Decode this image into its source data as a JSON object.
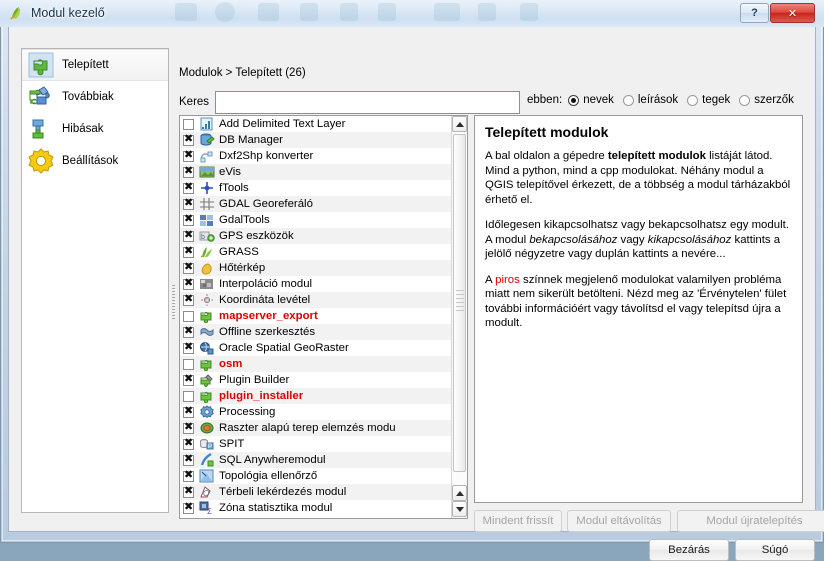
{
  "window": {
    "title": "Modul kezelő",
    "icon": "qgis-plugin-icon",
    "help_button": "?",
    "close_button": "✕"
  },
  "sidebar": {
    "items": [
      {
        "label": "Telepített",
        "icon": "puzzle-green-icon",
        "selected": true
      },
      {
        "label": "Továbbiak",
        "icon": "puzzle-blue-green-icon",
        "selected": false
      },
      {
        "label": "Hibásak",
        "icon": "puzzle-broken-icon",
        "selected": false
      },
      {
        "label": "Beállítások",
        "icon": "gear-yellow-icon",
        "selected": false
      }
    ]
  },
  "content": {
    "breadcrumb": "Modulok > Telepített (26)",
    "search": {
      "label": "Keres",
      "value": "",
      "placeholder": ""
    },
    "filter": {
      "label": "ebben:",
      "options": [
        {
          "label": "nevek",
          "selected": true
        },
        {
          "label": "leírások",
          "selected": false
        },
        {
          "label": "tegek",
          "selected": false
        },
        {
          "label": "szerzők",
          "selected": false
        }
      ]
    },
    "plugins": [
      {
        "name": "Add Delimited Text Layer",
        "checked": false,
        "broken": false,
        "icon": "delimited-text-icon"
      },
      {
        "name": "DB Manager",
        "checked": true,
        "broken": false,
        "icon": "db-manager-icon"
      },
      {
        "name": "Dxf2Shp konverter",
        "checked": true,
        "broken": false,
        "icon": "dxf2shp-icon"
      },
      {
        "name": "eVis",
        "checked": true,
        "broken": false,
        "icon": "evis-icon"
      },
      {
        "name": "fTools",
        "checked": true,
        "broken": false,
        "icon": "ftools-icon"
      },
      {
        "name": "GDAL Georeferáló",
        "checked": true,
        "broken": false,
        "icon": "georeferencer-icon"
      },
      {
        "name": "GdalTools",
        "checked": true,
        "broken": false,
        "icon": "gdaltools-icon"
      },
      {
        "name": "GPS eszközök",
        "checked": true,
        "broken": false,
        "icon": "gps-tools-icon"
      },
      {
        "name": "GRASS",
        "checked": true,
        "broken": false,
        "icon": "grass-icon"
      },
      {
        "name": "Hőtérkép",
        "checked": true,
        "broken": false,
        "icon": "heatmap-icon"
      },
      {
        "name": "Interpoláció modul",
        "checked": true,
        "broken": false,
        "icon": "interpolation-icon"
      },
      {
        "name": "Koordináta levétel",
        "checked": true,
        "broken": false,
        "icon": "coordinate-capture-icon"
      },
      {
        "name": "mapserver_export",
        "checked": false,
        "broken": true,
        "icon": "puzzle-green-icon"
      },
      {
        "name": "Offline szerkesztés",
        "checked": true,
        "broken": false,
        "icon": "offline-editing-icon"
      },
      {
        "name": "Oracle Spatial GeoRaster",
        "checked": true,
        "broken": false,
        "icon": "oracle-georaster-icon"
      },
      {
        "name": "osm",
        "checked": false,
        "broken": true,
        "icon": "puzzle-green-icon"
      },
      {
        "name": "Plugin Builder",
        "checked": true,
        "broken": false,
        "icon": "plugin-builder-icon"
      },
      {
        "name": "plugin_installer",
        "checked": false,
        "broken": true,
        "icon": "puzzle-green-icon"
      },
      {
        "name": "Processing",
        "checked": true,
        "broken": false,
        "icon": "processing-gear-icon"
      },
      {
        "name": "Raszter alapú terep elemzés modu",
        "checked": true,
        "broken": false,
        "icon": "raster-terrain-icon"
      },
      {
        "name": "SPIT",
        "checked": true,
        "broken": false,
        "icon": "spit-icon"
      },
      {
        "name": "SQL Anywheremodul",
        "checked": true,
        "broken": false,
        "icon": "sql-anywhere-icon"
      },
      {
        "name": "Topológia ellenőrző",
        "checked": true,
        "broken": false,
        "icon": "topology-checker-icon"
      },
      {
        "name": "Térbeli lekérdezés modul",
        "checked": true,
        "broken": false,
        "icon": "spatial-query-icon"
      },
      {
        "name": "Zóna statisztika modul",
        "checked": true,
        "broken": false,
        "icon": "zonal-statistics-icon"
      }
    ],
    "description": {
      "title": "Telepített modulok",
      "p1_a": "A bal oldalon a gépedre ",
      "p1_b": "telepített modulok",
      "p1_c": " listáját látod. Mind a python, mind a cpp modulokat. Néhány modul a QGIS telepítővel érkezett, de a többség a modul tárházakból érhető el.",
      "p2_a": "Időlegesen kikapcsolhatsz vagy bekapcsolhatsz egy modult. A modul ",
      "p2_b": "bekapcsolásához",
      "p2_c": " vagy ",
      "p2_d": "kikapcsolásához",
      "p2_e": " kattints a jelölő négyzetre vagy duplán kattints a nevére...",
      "p3_a": "A ",
      "p3_b": "piros",
      "p3_c": " színnek megjelenő modulokat valamilyen probléma miatt nem sikerült betölteni. Nézd meg az 'Érvénytelen' fület további információért vagy távolítsd el vagy telepítsd újra a modult."
    },
    "buttons": {
      "upgrade_all": "Mindent frissít",
      "uninstall": "Modul eltávolítás",
      "reinstall": "Modul újratelepítés",
      "close": "Bezárás",
      "help": "Súgó"
    }
  },
  "colors": {
    "broken_red": "#e00000",
    "accent_blue": "#5b9bd5",
    "title_gradient_top": "#eaf2fa",
    "close_red": "#c8261c",
    "dialog_bg": "#f0f0f0"
  }
}
